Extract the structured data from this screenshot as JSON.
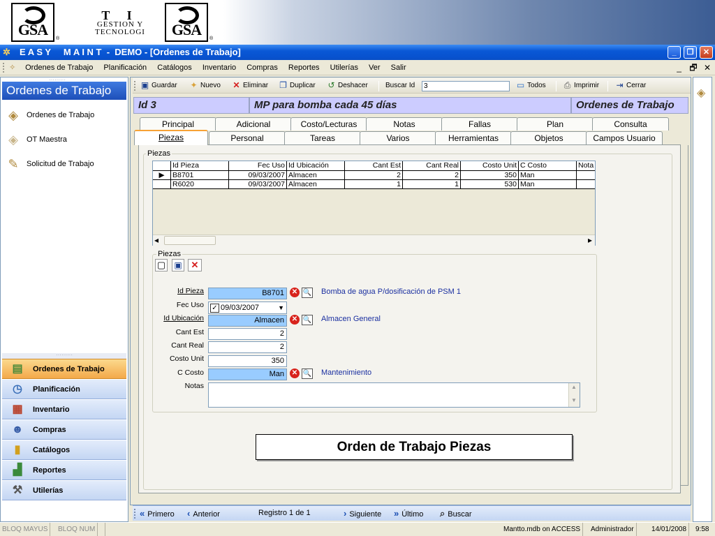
{
  "banner": {
    "logo_left": "GSA",
    "logo_right": "GSA",
    "line1": "T I",
    "line2": "GESTION Y",
    "line3": "TECNOLOGI",
    "reg": "®"
  },
  "window": {
    "title": "E A S Y     M A I N T  -  DEMO - [Ordenes de Trabajo]",
    "minimize": "_",
    "restore": "❐",
    "close": "✕"
  },
  "menu": {
    "items": [
      "Ordenes de Trabajo",
      "Planificación",
      "Catálogos",
      "Inventario",
      "Compras",
      "Reportes",
      "Utilerías",
      "Ver",
      "Salir"
    ],
    "mdi_min": "_",
    "mdi_restore": "🗗",
    "mdi_close": "✕"
  },
  "sidebar": {
    "header": "Ordenes de Trabajo",
    "links": [
      "Ordenes de Trabajo",
      "OT Maestra",
      "Solicitud de Trabajo"
    ],
    "splitter": "·········",
    "splitter_top": "·········",
    "buttons": [
      "Ordenes de Trabajo",
      "Planificación",
      "Inventario",
      "Compras",
      "Catálogos",
      "Reportes",
      "Utilerías"
    ],
    "active_button": "Ordenes de Trabajo"
  },
  "toolbar": {
    "guardar": "Guardar",
    "nuevo": "Nuevo",
    "eliminar": "Eliminar",
    "duplicar": "Duplicar",
    "deshacer": "Deshacer",
    "buscar_id": "Buscar Id",
    "buscar_value": "3",
    "todos": "Todos",
    "imprimir": "Imprimir",
    "cerrar": "Cerrar"
  },
  "header": {
    "id": "Id  3",
    "description": "MP para bomba cada 45 días",
    "form_name": "Ordenes de Trabajo"
  },
  "tabs": {
    "row1": [
      "Principal",
      "Adicional",
      "Costo/Lecturas",
      "Notas",
      "Fallas",
      "Plan",
      "Consulta"
    ],
    "row2": [
      "Piezas",
      "Personal",
      "Tareas",
      "Varios",
      "Herramientas",
      "Objetos",
      "Campos Usuario"
    ],
    "selected": "Piezas"
  },
  "piezas_group": "Piezas",
  "grid": {
    "columns": [
      "Id Pieza",
      "Fec Uso",
      "Id Ubicación",
      "Cant Est",
      "Cant Real",
      "Costo Unit",
      "C Costo",
      "Nota"
    ],
    "rows": [
      [
        "B8701",
        "09/03/2007",
        "Almacen",
        "2",
        "2",
        "350",
        "Man",
        ""
      ],
      [
        "R6020",
        "09/03/2007",
        "Almacen",
        "1",
        "1",
        "530",
        "Man",
        ""
      ]
    ],
    "row_marker": "▶",
    "scroll_left": "◂",
    "scroll_right": "▸"
  },
  "detail": {
    "group_label": "Piezas",
    "labels": {
      "id_pieza": "Id Pieza",
      "fec_uso": "Fec Uso",
      "id_ubicacion": "Id Ubicación",
      "cant_est": "Cant Est",
      "cant_real": "Cant Real",
      "costo_unit": "Costo Unit",
      "c_costo": "C Costo",
      "notas": "Notas"
    },
    "values": {
      "id_pieza": "B8701",
      "fec_uso": "09/03/2007",
      "fec_uso_checked": "✓",
      "id_ubicacion": "Almacen",
      "cant_est": "2",
      "cant_real": "2",
      "costo_unit": "350",
      "c_costo": "Man",
      "notas": ""
    },
    "descriptions": {
      "id_pieza": "Bomba de agua P/dosificación de PSM 1",
      "id_ubicacion": "Almacen General",
      "c_costo": "Mantenimiento"
    },
    "clear_glyph": "✕",
    "lookup_glyph": "🔍",
    "dropdown": "▼",
    "scroll_up": "▲",
    "scroll_down": "▼"
  },
  "caption": "Orden de Trabajo Piezas",
  "navigation": {
    "primero": "Primero",
    "anterior": "Anterior",
    "registro": "Registro 1 de 1",
    "siguiente": "Siguiente",
    "ultimo": "Último",
    "buscar": "Buscar"
  },
  "status": {
    "caps": "BLOQ MAYUS",
    "num": "BLOQ NUM",
    "db": "Mantto.mdb on ACCESS",
    "user": "Administrador",
    "date": "14/01/2008",
    "time": "9:58"
  }
}
